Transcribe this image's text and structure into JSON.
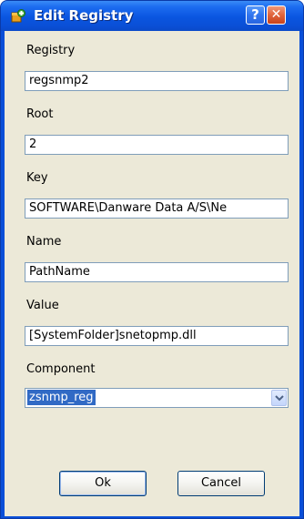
{
  "window": {
    "title": "Edit Registry",
    "help_glyph": "?",
    "close_glyph": "✕",
    "title_icon": "registry-package-icon"
  },
  "form": {
    "registry": {
      "label": "Registry",
      "value": "regsnmp2"
    },
    "root": {
      "label": "Root",
      "value": "2"
    },
    "key": {
      "label": "Key",
      "value": "SOFTWARE\\Danware Data A/S\\Ne"
    },
    "name": {
      "label": "Name",
      "value": "PathName"
    },
    "value": {
      "label": "Value",
      "value": "[SystemFolder]snetopmp.dll"
    },
    "component": {
      "label": "Component",
      "selected": "zsnmp_reg"
    }
  },
  "buttons": {
    "ok": "Ok",
    "cancel": "Cancel"
  },
  "colors": {
    "titlebar": "#0a55e0",
    "dialog_face": "#ece9d8",
    "selection": "#316ac5",
    "field_border": "#7f9db9"
  }
}
